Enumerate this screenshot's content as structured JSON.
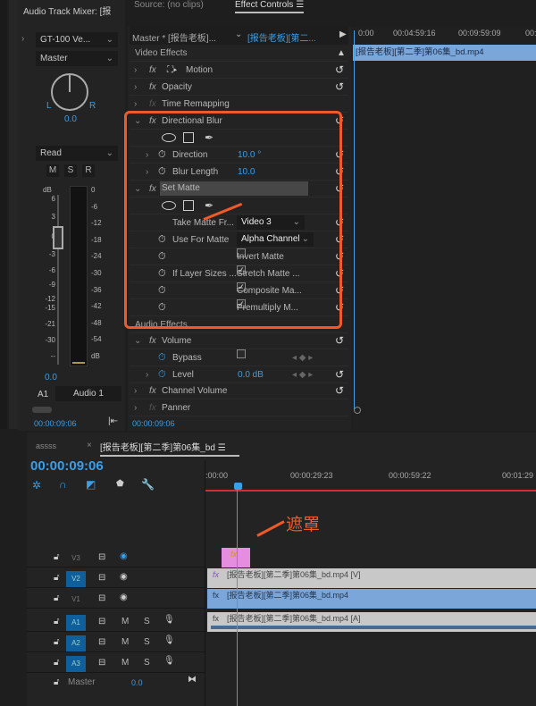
{
  "mixer": {
    "title": "Audio Track Mixer: [报",
    "input": "GT-100 Ve...",
    "output": "Master",
    "pan_L": "L",
    "pan_R": "R",
    "pan_value": "0.0",
    "automation": "Read",
    "m": "M",
    "s": "S",
    "r": "R",
    "db_label": "dB",
    "left_scale": [
      "6",
      "3",
      "0",
      "-3",
      "-6",
      "-9",
      "-12",
      "-15",
      "-21",
      "-30",
      "--"
    ],
    "right_scale": [
      "0",
      "-6",
      "-12",
      "-18",
      "-24",
      "-30",
      "-36",
      "-42",
      "-48",
      "-54",
      "dB"
    ],
    "level": "0.0",
    "track_id": "A1",
    "track_name": "Audio 1",
    "time": "00:00:09:06"
  },
  "tabs": {
    "source": "Source: (no clips)",
    "effect_controls": "Effect Controls"
  },
  "ec": {
    "master": "Master * [报告老板]...",
    "clip": "[报告老板][第二...",
    "ruler": [
      "0:00",
      "00:04:59:16",
      "00:09:59:09",
      "00:"
    ],
    "clip_bar": "[报告老板][第二季]第06集_bd.mp4",
    "time": "00:00:09:06",
    "video_effects": "Video Effects",
    "motion": "Motion",
    "opacity": "Opacity",
    "time_remapping": "Time Remapping",
    "directional_blur": "Directional Blur",
    "direction": "Direction",
    "direction_value": "10.0 °",
    "blur_length": "Blur Length",
    "blur_length_value": "10.0",
    "set_matte": "Set Matte",
    "take_matte": "Take Matte Fr...",
    "take_matte_value": "Video 3",
    "use_for_matte": "Use For Matte",
    "use_for_matte_value": "Alpha Channel",
    "invert_matte": "Invert Matte",
    "if_layer_sizes": "If Layer Sizes ...",
    "stretch_matte": "Stretch Matte ...",
    "composite_matte": "Composite Ma...",
    "premultiply": "Premultiply M...",
    "audio_effects": "Audio Effects",
    "volume": "Volume",
    "bypass": "Bypass",
    "level": "Level",
    "level_value": "0.0 dB",
    "channel_volume": "Channel Volume",
    "panner": "Panner"
  },
  "checks": {
    "invert": false,
    "stretch": true,
    "composite": true,
    "premultiply": true,
    "bypass": false
  },
  "timeline": {
    "tab1": "assss",
    "tab2": "[报告老板][第二季]第06集_bd",
    "time": "00:00:09:06",
    "ruler": [
      ":00:00",
      "00:00:29:23",
      "00:00:59:22",
      "00:01:29"
    ],
    "annotation": "遮罩",
    "tracks": [
      "V3",
      "V2",
      "V1",
      "A1",
      "A2",
      "A3"
    ],
    "master": "Master",
    "master_value": "0.0",
    "clip_v2": "[报告老板][第二季]第06集_bd.mp4 [V]",
    "clip_v1": "[报告老板][第二季]第06集_bd.mp4",
    "clip_a1": "[报告老板][第二季]第06集_bd.mp4 [A]",
    "m": "M",
    "s": "S"
  },
  "colors": {
    "accent": "#3a9ee8",
    "highlight": "#f05a28",
    "matte_clip": "#e58ee0",
    "v1_clip": "#7aa6d9",
    "v2_clip": "#c8c8c8"
  }
}
